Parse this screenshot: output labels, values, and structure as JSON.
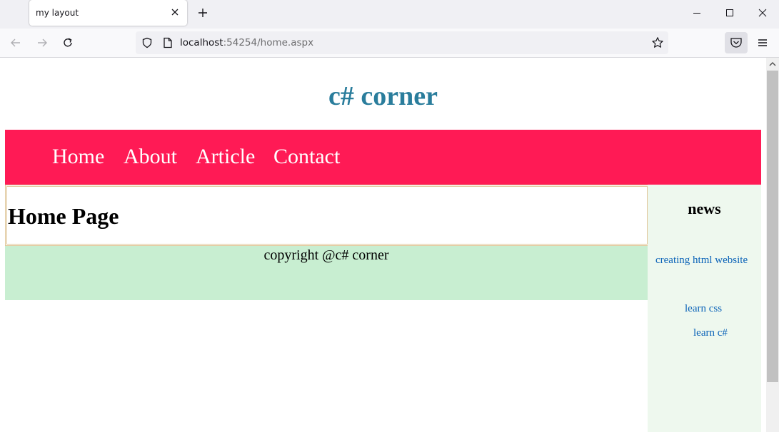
{
  "browser": {
    "tab_title": "my layout",
    "url_host": "localhost",
    "url_rest": ":54254/home.aspx"
  },
  "site": {
    "title": "c# corner",
    "nav": [
      "Home",
      "About",
      "Article",
      "Contact"
    ],
    "content_title": "Home Page",
    "footer": "copyright @c# corner",
    "aside": {
      "title": "news",
      "links": [
        "creating html website",
        "learn css",
        "learn c#"
      ]
    }
  },
  "colors": {
    "title": "#2a7d9c",
    "nav_bg": "#ff1a55",
    "footer_bg": "#c8eed1",
    "aside_bg": "#eef8ee",
    "link": "#0b63b8"
  },
  "icons": [
    "close-icon",
    "plus-icon",
    "minimize-icon",
    "maximize-icon",
    "back-arrow-icon",
    "forward-arrow-icon",
    "reload-icon",
    "shield-icon",
    "page-icon",
    "star-icon",
    "pocket-icon",
    "hamburger-menu-icon",
    "scroll-up-arrow-icon"
  ]
}
